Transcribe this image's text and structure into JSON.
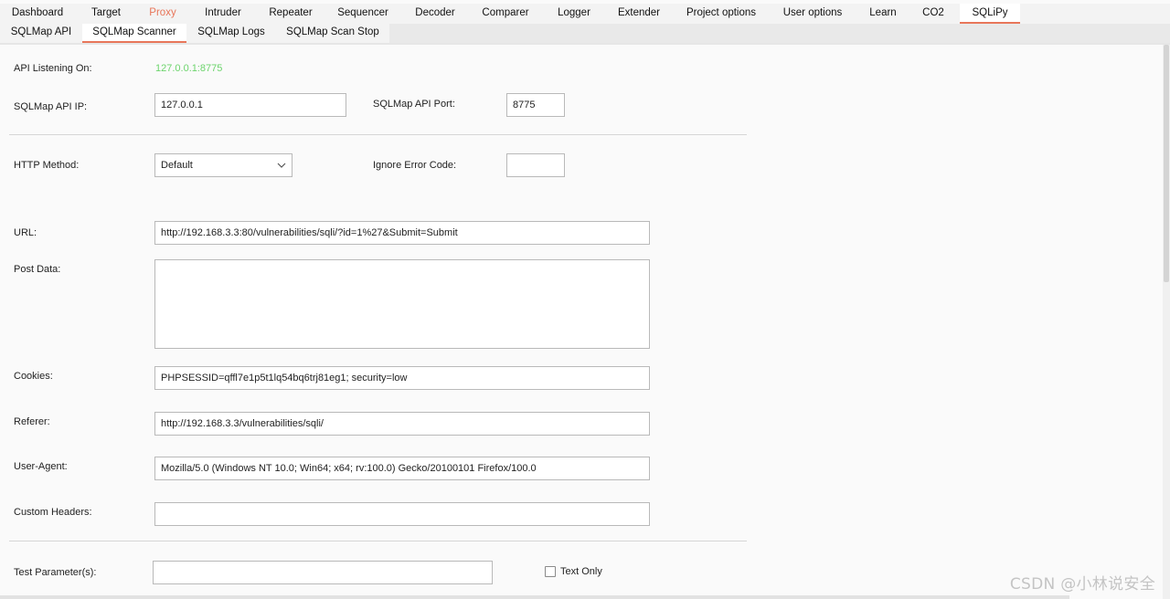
{
  "main_tabs": [
    {
      "label": "Dashboard"
    },
    {
      "label": "Target"
    },
    {
      "label": "Proxy"
    },
    {
      "label": "Intruder"
    },
    {
      "label": "Repeater"
    },
    {
      "label": "Sequencer"
    },
    {
      "label": "Decoder"
    },
    {
      "label": "Comparer"
    },
    {
      "label": "Logger"
    },
    {
      "label": "Extender"
    },
    {
      "label": "Project options"
    },
    {
      "label": "User options"
    },
    {
      "label": "Learn"
    },
    {
      "label": "CO2"
    },
    {
      "label": "SQLiPy"
    }
  ],
  "sub_tabs": [
    {
      "label": "SQLMap API"
    },
    {
      "label": "SQLMap Scanner"
    },
    {
      "label": "SQLMap Logs"
    },
    {
      "label": "SQLMap Scan Stop"
    }
  ],
  "form": {
    "api_listening_label": "API Listening On:",
    "api_listening_value": "127.0.0.1:8775",
    "api_ip_label": "SQLMap API IP:",
    "api_ip_value": "127.0.0.1",
    "api_port_label": "SQLMap API Port:",
    "api_port_value": "8775",
    "http_method_label": "HTTP Method:",
    "http_method_value": "Default",
    "ignore_error_label": "Ignore Error Code:",
    "ignore_error_value": "",
    "url_label": "URL:",
    "url_value": "http://192.168.3.3:80/vulnerabilities/sqli/?id=1%27&Submit=Submit",
    "post_data_label": "Post Data:",
    "post_data_value": "",
    "cookies_label": "Cookies:",
    "cookies_value": "PHPSESSID=qffl7e1p5t1lq54bq6trj81eg1; security=low",
    "referer_label": "Referer:",
    "referer_value": "http://192.168.3.3/vulnerabilities/sqli/",
    "user_agent_label": "User-Agent:",
    "user_agent_value": "Mozilla/5.0 (Windows NT 10.0; Win64; x64; rv:100.0) Gecko/20100101 Firefox/100.0",
    "custom_headers_label": "Custom Headers:",
    "custom_headers_value": "",
    "test_param_label": "Test Parameter(s):",
    "test_param_value": "",
    "text_only_label": "Text Only"
  },
  "colors": {
    "accent": "#e8765a",
    "listening_value": "#6cd46c"
  },
  "watermark": "CSDN @小林说安全"
}
